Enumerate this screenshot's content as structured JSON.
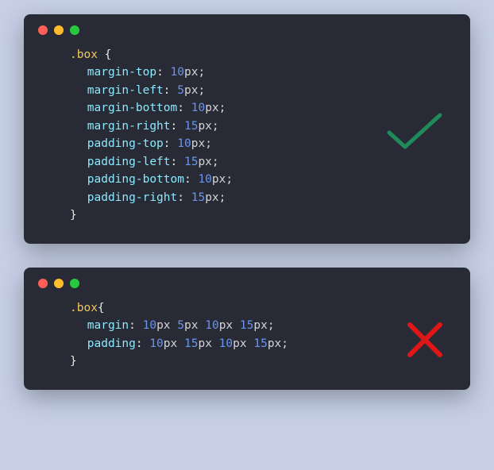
{
  "blocks": [
    {
      "mark": "check",
      "selector": ".box",
      "selector_space": " ",
      "lines": [
        {
          "prop": "margin-top",
          "values": [
            {
              "num": "10",
              "unit": "px"
            }
          ]
        },
        {
          "prop": "margin-left",
          "values": [
            {
              "num": "5",
              "unit": "px"
            }
          ]
        },
        {
          "prop": "margin-bottom",
          "values": [
            {
              "num": "10",
              "unit": "px"
            }
          ]
        },
        {
          "prop": "margin-right",
          "values": [
            {
              "num": "15",
              "unit": "px"
            }
          ]
        },
        {
          "prop": "padding-top",
          "values": [
            {
              "num": "10",
              "unit": "px"
            }
          ]
        },
        {
          "prop": "padding-left",
          "values": [
            {
              "num": "15",
              "unit": "px"
            }
          ]
        },
        {
          "prop": "padding-bottom",
          "values": [
            {
              "num": "10",
              "unit": "px"
            }
          ]
        },
        {
          "prop": "padding-right",
          "values": [
            {
              "num": "15",
              "unit": "px"
            }
          ]
        }
      ]
    },
    {
      "mark": "cross",
      "selector": ".box",
      "selector_space": "",
      "lines": [
        {
          "prop": "margin",
          "values": [
            {
              "num": "10",
              "unit": "px"
            },
            {
              "num": "5",
              "unit": "px"
            },
            {
              "num": "10",
              "unit": "px"
            },
            {
              "num": "15",
              "unit": "px"
            }
          ]
        },
        {
          "prop": "padding",
          "values": [
            {
              "num": "10",
              "unit": "px"
            },
            {
              "num": "15",
              "unit": "px"
            },
            {
              "num": "10",
              "unit": "px"
            },
            {
              "num": "15",
              "unit": "px"
            }
          ]
        }
      ]
    }
  ],
  "colors": {
    "check": "#1f8a5a",
    "cross": "#e01717"
  }
}
